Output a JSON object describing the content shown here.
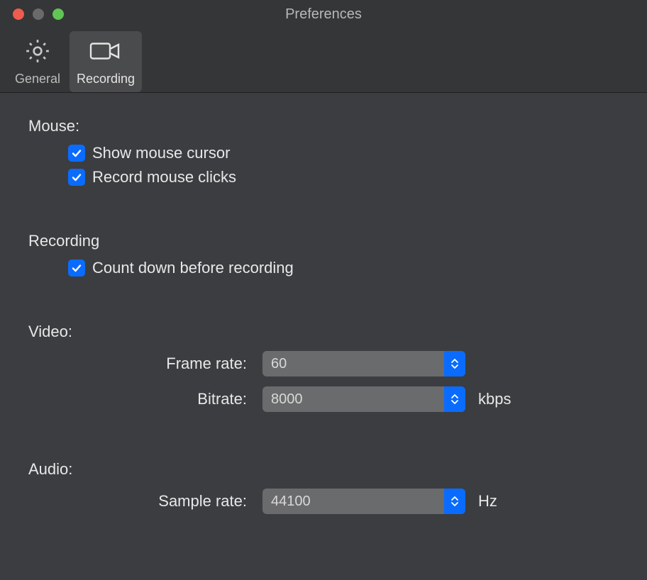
{
  "window": {
    "title": "Preferences"
  },
  "tabs": {
    "general": "General",
    "recording": "Recording"
  },
  "sections": {
    "mouse": {
      "label": "Mouse:",
      "show_cursor": "Show mouse cursor",
      "record_clicks": "Record mouse clicks"
    },
    "recording": {
      "label": "Recording",
      "count_down": "Count down before recording"
    },
    "video": {
      "label": "Video:",
      "framerate_label": "Frame rate:",
      "framerate_value": "60",
      "bitrate_label": "Bitrate:",
      "bitrate_value": "8000",
      "bitrate_unit": "kbps"
    },
    "audio": {
      "label": "Audio:",
      "samplerate_label": "Sample rate:",
      "samplerate_value": "44100",
      "samplerate_unit": "Hz"
    }
  }
}
